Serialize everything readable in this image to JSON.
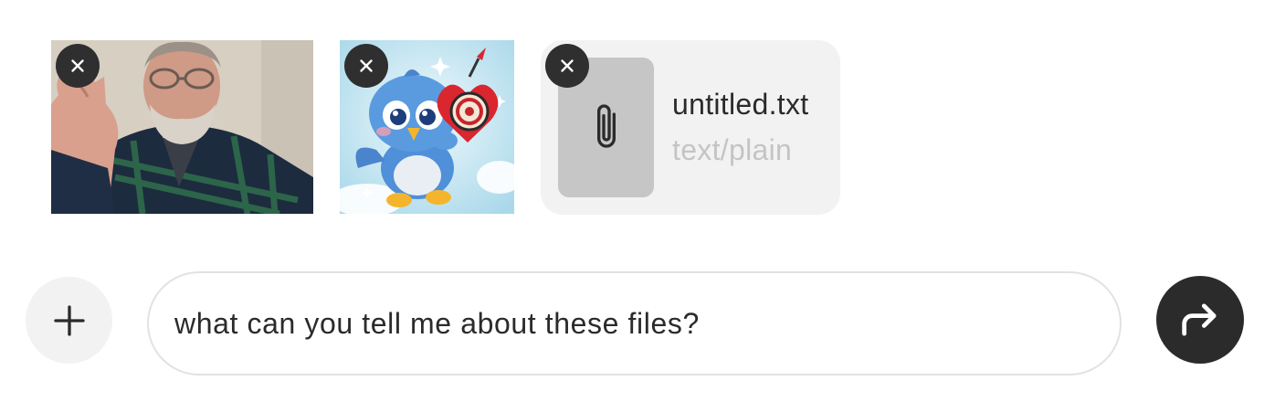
{
  "attachments": {
    "images": [
      {
        "kind": "photo",
        "icon": "person-photo",
        "remove_icon": "close-icon"
      },
      {
        "kind": "photo",
        "icon": "cartoon-bird-heart-dartboard",
        "remove_icon": "close-icon"
      }
    ],
    "file": {
      "name": "untitled.txt",
      "type": "text/plain",
      "icon": "paperclip-icon",
      "remove_icon": "close-icon"
    }
  },
  "composer": {
    "add_icon": "plus-icon",
    "message_value": "what can you tell me about these files?",
    "send_icon": "send-arrow-icon"
  },
  "colors": {
    "dark_button": "#2b2b2b",
    "light_surface": "#f2f2f2",
    "file_icon_bg": "#c6c6c6",
    "muted_text": "#c4c4c4",
    "input_border": "#e2e2e2"
  }
}
